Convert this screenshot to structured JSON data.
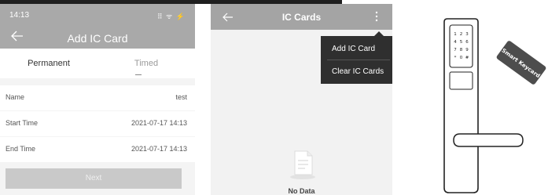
{
  "panel_add_card": {
    "status_time": "14:13",
    "status_icons": "⠿ ᯤ ⚡",
    "title": "Add IC Card",
    "tabs": [
      {
        "label": "Permanent",
        "active": true
      },
      {
        "label": "Timed",
        "active": false
      }
    ],
    "fields": [
      {
        "label": "Name",
        "value": "test"
      },
      {
        "label": "Start Time",
        "value": "2021-07-17 14:13"
      },
      {
        "label": "End Time",
        "value": "2021-07-17 14:13"
      }
    ],
    "next_label": "Next",
    "colors": {
      "header": "#a9a9a9",
      "button": "#c9c9c9"
    }
  },
  "panel_ic_cards": {
    "title": "IC Cards",
    "menu_items": [
      "Add IC Card",
      "Clear IC Cards"
    ],
    "empty_text": "No Data",
    "colors": {
      "header": "#a4a4a4",
      "menu": "#2f2f2f"
    }
  },
  "illustration": {
    "keycard_text": "Smart Keycard",
    "keypad_keys": [
      "1",
      "2",
      "3",
      "4",
      "5",
      "6",
      "7",
      "8",
      "9",
      "*",
      "0",
      "#"
    ]
  }
}
